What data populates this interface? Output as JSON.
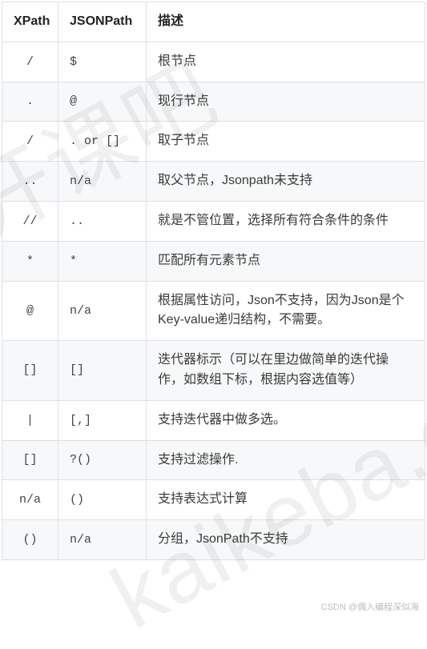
{
  "table": {
    "headers": [
      "XPath",
      "JSONPath",
      "描述"
    ],
    "rows": [
      {
        "xpath": "/",
        "jsonpath": "$",
        "desc": "根节点"
      },
      {
        "xpath": ".",
        "jsonpath": "@",
        "desc": "现行节点"
      },
      {
        "xpath": "/",
        "jsonpath": ". or []",
        "desc": "取子节点"
      },
      {
        "xpath": "..",
        "jsonpath": "n/a",
        "desc": "取父节点，Jsonpath未支持"
      },
      {
        "xpath": "//",
        "jsonpath": "..",
        "desc": "就是不管位置，选择所有符合条件的条件"
      },
      {
        "xpath": "*",
        "jsonpath": "*",
        "desc": "匹配所有元素节点"
      },
      {
        "xpath": "@",
        "jsonpath": "n/a",
        "desc": "根据属性访问，Json不支持，因为Json是个Key-value递归结构，不需要。"
      },
      {
        "xpath": "[]",
        "jsonpath": "[]",
        "desc": "迭代器标示（可以在里边做简单的迭代操作，如数组下标，根据内容选值等）"
      },
      {
        "xpath": "|",
        "jsonpath": "[,]",
        "desc": "支持迭代器中做多选。"
      },
      {
        "xpath": "[]",
        "jsonpath": "?()",
        "desc": "支持过滤操作."
      },
      {
        "xpath": "n/a",
        "jsonpath": "()",
        "desc": "支持表达式计算"
      },
      {
        "xpath": "()",
        "jsonpath": "n/a",
        "desc": "分组，JsonPath不支持"
      }
    ]
  },
  "watermark1": "开课吧",
  "watermark2": "kaikeba.co",
  "footer": "CSDN @偶入编程深似海"
}
